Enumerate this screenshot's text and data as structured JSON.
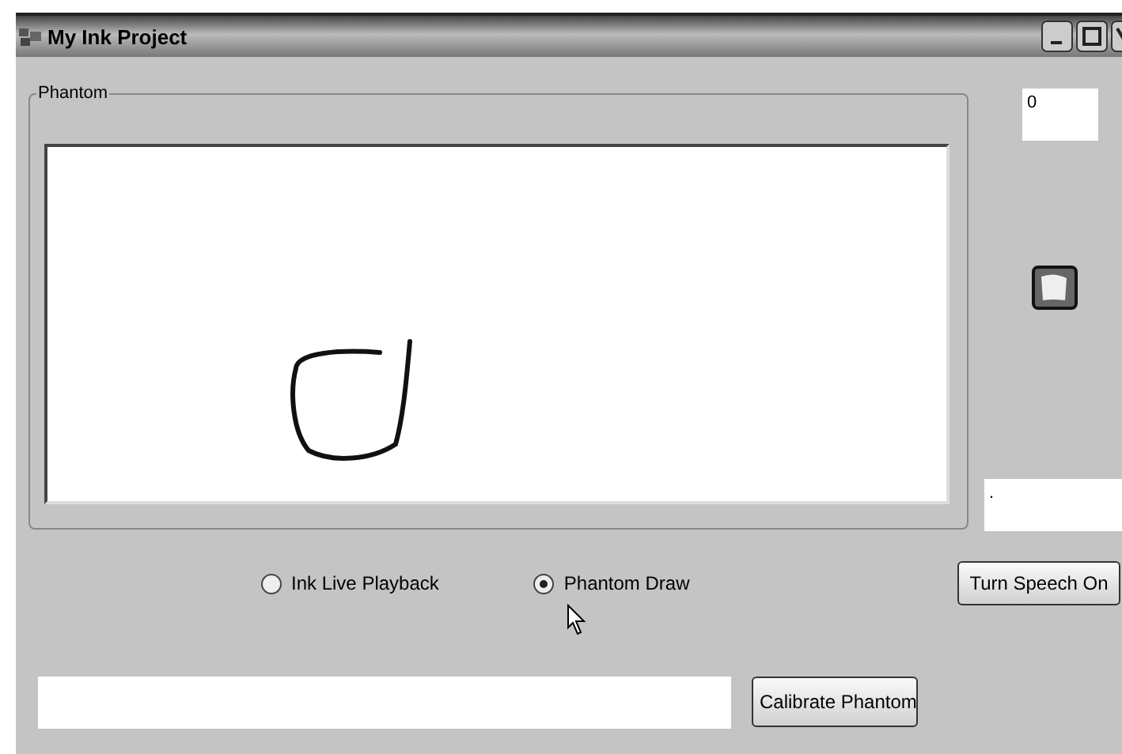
{
  "window": {
    "title": "My Ink Project"
  },
  "group": {
    "label": "Phantom"
  },
  "counter_field": {
    "value": "0"
  },
  "status_field": {
    "value": "."
  },
  "modes": [
    {
      "label": "Ink Live Playback",
      "selected": false
    },
    {
      "label": "Phantom Draw",
      "selected": true
    }
  ],
  "buttons": [
    {
      "label": "Turn Speech On"
    },
    {
      "label": "Calibrate Phantom"
    }
  ]
}
